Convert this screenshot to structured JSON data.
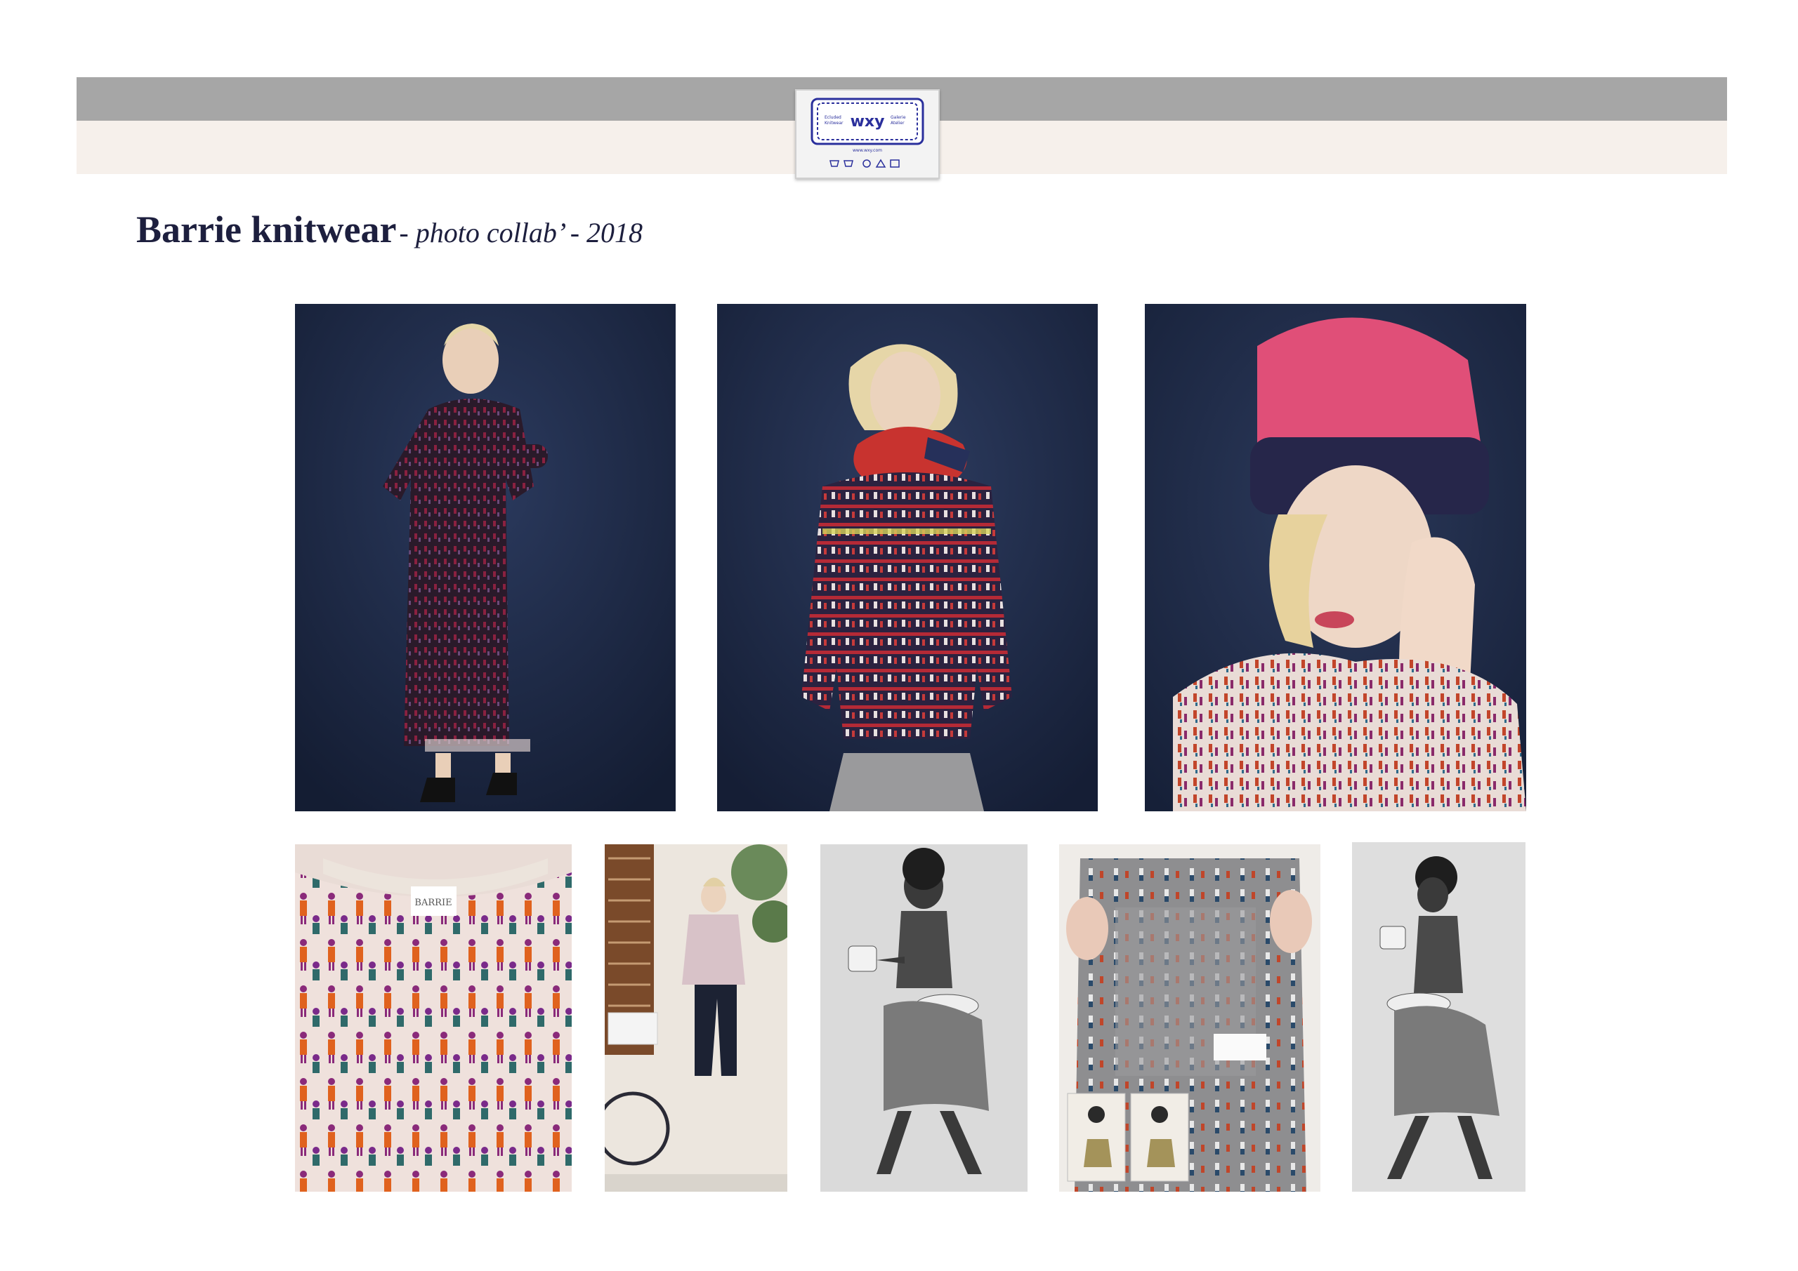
{
  "header": {
    "logo": {
      "text": "wxy",
      "left_text": "Ecluded Knitwear",
      "right_text": "Galerie Atelier",
      "bottom_text": "www.wxy.com",
      "icon": "care-label-logo",
      "color": "#2a2f9c"
    }
  },
  "title": {
    "main": "Barrie knitwear",
    "sub": "- photo collab’ - 2018",
    "color": "#1d1f3e"
  },
  "photos": [
    {
      "name": "photo-model-long-dress",
      "alt": "Model in patterned knit long dress on navy backdrop"
    },
    {
      "name": "photo-model-sweater-scarf",
      "alt": "Model in striped patterned sweater with red scarf"
    },
    {
      "name": "photo-model-beanie",
      "alt": "Model wearing pink and navy beanie, close-up"
    },
    {
      "name": "photo-knit-detail",
      "alt": "Close-up of knit pattern with BARRIE label",
      "label": "BARRIE"
    },
    {
      "name": "photo-model-bicycle",
      "alt": "Model with bicycle outdoors"
    },
    {
      "name": "photo-bw-child-1",
      "alt": "Black and white photo of child carrying a mug and bowl"
    },
    {
      "name": "photo-knit-sample",
      "alt": "Hands holding grey knit sample with reference photos"
    },
    {
      "name": "photo-bw-child-2",
      "alt": "Black and white photo of child walking with mug"
    }
  ],
  "colors": {
    "band_dark": "#a6a6a6",
    "band_light": "#f6f0eb",
    "backdrop": "#1e2b47"
  }
}
